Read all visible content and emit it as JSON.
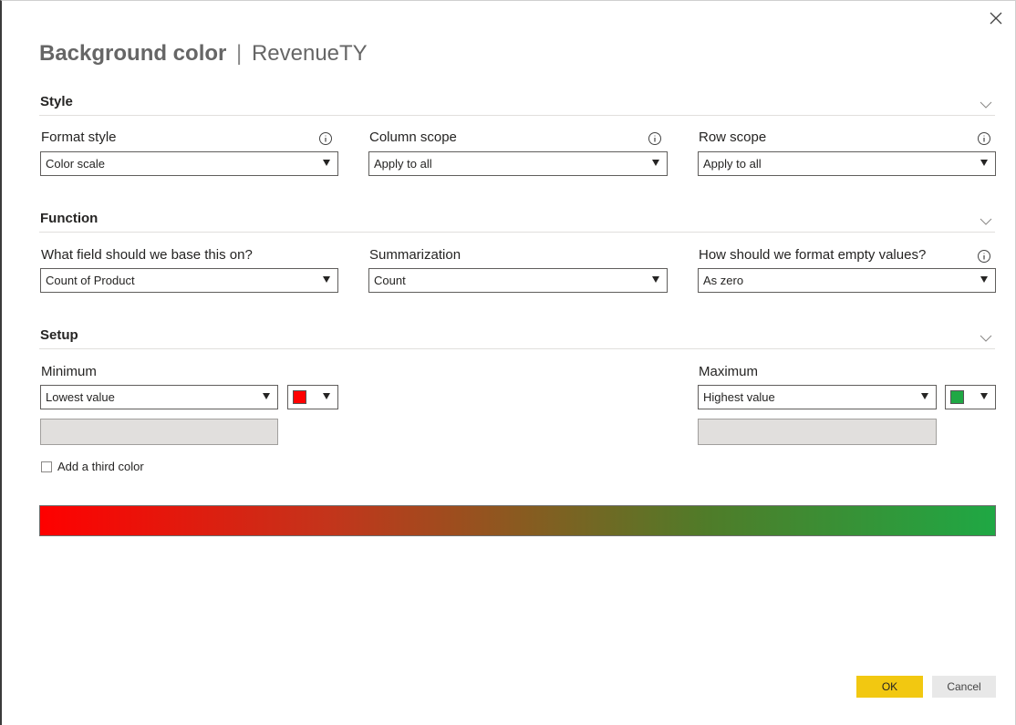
{
  "dialog": {
    "title_main": "Background color",
    "title_separator": "|",
    "title_field": "RevenueTY"
  },
  "style": {
    "heading": "Style",
    "format_style": {
      "label": "Format style",
      "value": "Color scale"
    },
    "column_scope": {
      "label": "Column scope",
      "value": "Apply to all"
    },
    "row_scope": {
      "label": "Row scope",
      "value": "Apply to all"
    }
  },
  "function": {
    "heading": "Function",
    "base_field": {
      "label": "What field should we base this on?",
      "value": "Count of Product"
    },
    "summarization": {
      "label": "Summarization",
      "value": "Count"
    },
    "empty_values": {
      "label": "How should we format empty values?",
      "value": "As zero"
    }
  },
  "setup": {
    "heading": "Setup",
    "minimum": {
      "label": "Minimum",
      "value": "Lowest value",
      "color": "#ff0000"
    },
    "maximum": {
      "label": "Maximum",
      "value": "Highest value",
      "color": "#1fa844"
    },
    "third_color_label": "Add a third color",
    "third_color_checked": false
  },
  "colors": {
    "accent": "#f2c811",
    "gradient_start": "#ff0000",
    "gradient_end": "#1fa844"
  },
  "icons": {
    "close": "close-icon",
    "chevron": "chevron-down-icon",
    "info": "info-icon"
  },
  "buttons": {
    "ok": "OK",
    "cancel": "Cancel"
  }
}
